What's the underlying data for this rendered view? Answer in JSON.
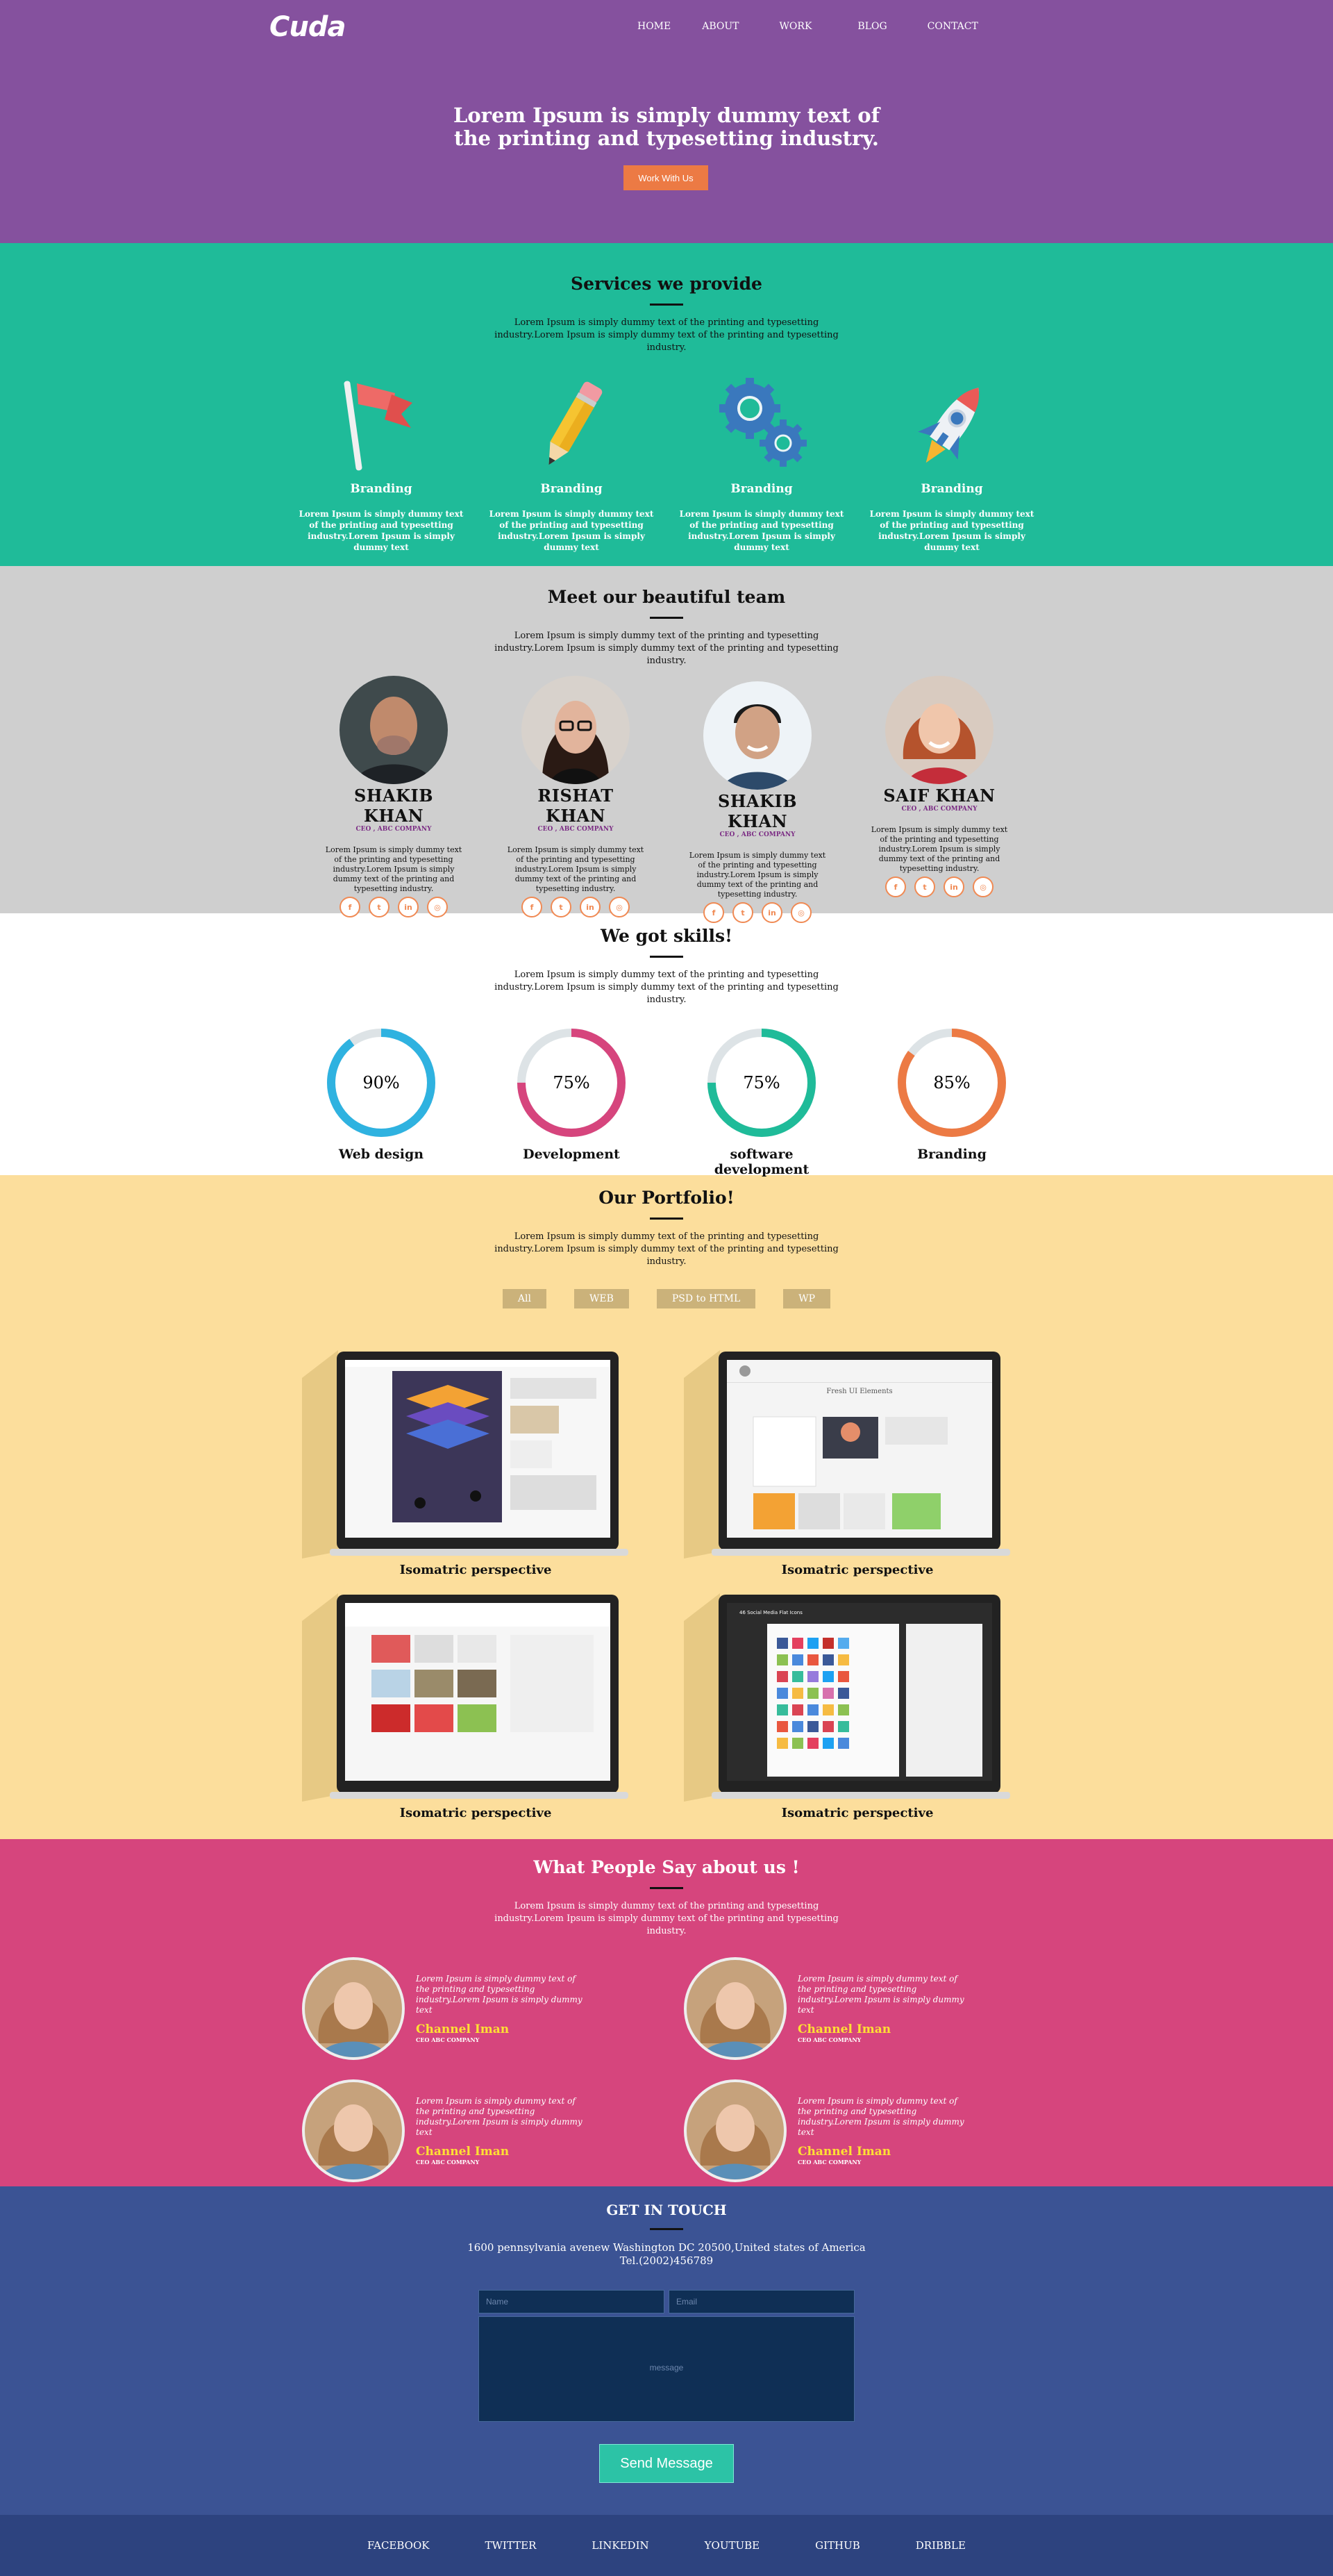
{
  "header": {
    "logo": "Cuda",
    "nav": [
      "HOME",
      "ABOUT",
      "WORK",
      "BLOG",
      "CONTACT"
    ],
    "hero_title": "Lorem Ipsum is simply dummy text of the printing and typesetting industry.",
    "cta": "Work With Us"
  },
  "services": {
    "title": "Services we provide",
    "intro": "Lorem Ipsum is simply dummy text of the printing and typesetting industry.Lorem Ipsum is simply dummy text of the printing and typesetting industry.",
    "items": [
      {
        "icon": "flag-icon",
        "title": "Branding",
        "text": "Lorem Ipsum is simply dummy text of the printing and typesetting industry.Lorem Ipsum is simply dummy text"
      },
      {
        "icon": "pencil-icon",
        "title": "Branding",
        "text": "Lorem Ipsum is simply dummy text of the printing and typesetting industry.Lorem Ipsum is simply dummy text"
      },
      {
        "icon": "gears-icon",
        "title": "Branding",
        "text": "Lorem Ipsum is simply dummy text of the printing and typesetting industry.Lorem Ipsum is simply dummy text"
      },
      {
        "icon": "rocket-icon",
        "title": "Branding",
        "text": "Lorem Ipsum is simply dummy text of the printing and typesetting industry.Lorem Ipsum is simply dummy text"
      }
    ]
  },
  "team": {
    "title": "Meet our beautiful team",
    "intro": "Lorem Ipsum is simply dummy text of the printing and typesetting industry.Lorem Ipsum is simply dummy text of the printing and typesetting industry.",
    "members": [
      {
        "name": "SHAKIB KHAN",
        "role": "CEO , ABC COMPANY",
        "text": "Lorem Ipsum is simply dummy text of the printing and typesetting industry.Lorem Ipsum is simply dummy text of the printing and typesetting industry."
      },
      {
        "name": "RISHAT KHAN",
        "role": "CEO , ABC COMPANY",
        "text": "Lorem Ipsum is simply dummy text of the printing and typesetting industry.Lorem Ipsum is simply dummy text of the printing and typesetting industry."
      },
      {
        "name": "SHAKIB KHAN",
        "role": "CEO , ABC COMPANY",
        "text": "Lorem Ipsum is simply dummy text of the printing and typesetting industry.Lorem Ipsum is simply dummy text of the printing and typesetting industry."
      },
      {
        "name": "SAIF KHAN",
        "role": "CEO , ABC COMPANY",
        "text": "Lorem Ipsum is simply dummy text of the printing and typesetting industry.Lorem Ipsum is simply dummy text of the printing and typesetting industry."
      }
    ],
    "social_icons": [
      "facebook-icon",
      "twitter-icon",
      "linkedin-icon",
      "instagram-icon"
    ],
    "social_color": "#f08a54"
  },
  "skills": {
    "title": "We got skills!",
    "intro": "Lorem Ipsum is simply dummy text of the printing and typesetting industry.Lorem Ipsum is simply dummy text of the printing and typesetting industry.",
    "items": [
      {
        "label": "Web design",
        "value": 90,
        "display": "90%",
        "color": "#2fb2e0"
      },
      {
        "label": "Development",
        "value": 75,
        "display": "75%",
        "color": "#d6457d"
      },
      {
        "label": "software development",
        "value": 75,
        "display": "75%",
        "color": "#1fbb99"
      },
      {
        "label": "Branding",
        "value": 85,
        "display": "85%",
        "color": "#ec7a44"
      }
    ],
    "track_color": "#dde3e6"
  },
  "portfolio": {
    "title": "Our Portfolio!",
    "intro": "Lorem Ipsum is simply dummy text of the printing and typesetting industry.Lorem Ipsum is simply dummy text of the printing and typesetting industry.",
    "filters": [
      "All",
      "WEB",
      "PSD to HTML",
      "WP"
    ],
    "items": [
      {
        "title": "Isomatric perspective",
        "screen_caption": ""
      },
      {
        "title": "Isomatric perspective",
        "screen_caption": "Fresh UI Elements"
      },
      {
        "title": "Isomatric perspective",
        "screen_caption": ""
      },
      {
        "title": "Isomatric perspective",
        "screen_caption": "46 Social Media Flat Icons"
      }
    ]
  },
  "testimonials": {
    "title": "What People Say about us !",
    "intro": "Lorem Ipsum is simply dummy text of the printing and typesetting industry.Lorem Ipsum is simply dummy text of the printing and typesetting industry.",
    "items": [
      {
        "quote": "Lorem Ipsum is simply dummy text of the printing and typesetting industry.Lorem Ipsum is simply dummy text",
        "name": "Channel Iman",
        "company": "CEO ABC COMPANY"
      },
      {
        "quote": "Lorem Ipsum is simply dummy text of the printing and typesetting industry.Lorem Ipsum is simply dummy text",
        "name": "Channel Iman",
        "company": "CEO ABC COMPANY"
      },
      {
        "quote": "Lorem Ipsum is simply dummy text of the printing and typesetting industry.Lorem Ipsum is simply dummy text",
        "name": "Channel Iman",
        "company": "CEO ABC COMPANY"
      },
      {
        "quote": "Lorem Ipsum is simply dummy text of the printing and typesetting industry.Lorem Ipsum is simply dummy text",
        "name": "Channel Iman",
        "company": "CEO ABC COMPANY"
      }
    ]
  },
  "contact": {
    "title": "GET IN TOUCH",
    "address": "1600 pennsylvania avenew Washington DC 20500,United states of America",
    "tel": "Tel.(2002)456789",
    "name_placeholder": "Name",
    "email_placeholder": "Email",
    "message_placeholder": "message",
    "send": "Send Message"
  },
  "footer": {
    "links": [
      "FACEBOOK",
      "TWITTER",
      "LINKEDIN",
      "YOUTUBE",
      "GITHUB",
      "DRIBBLE"
    ]
  },
  "colors": {
    "header": "#85519e",
    "services": "#1fbb99",
    "team": "#cfcfcf",
    "portfolio": "#fcde9c",
    "testimonials": "#d6457d",
    "contact": "#3b5394",
    "footer": "#2d437f",
    "accent": "#ec7a44"
  }
}
